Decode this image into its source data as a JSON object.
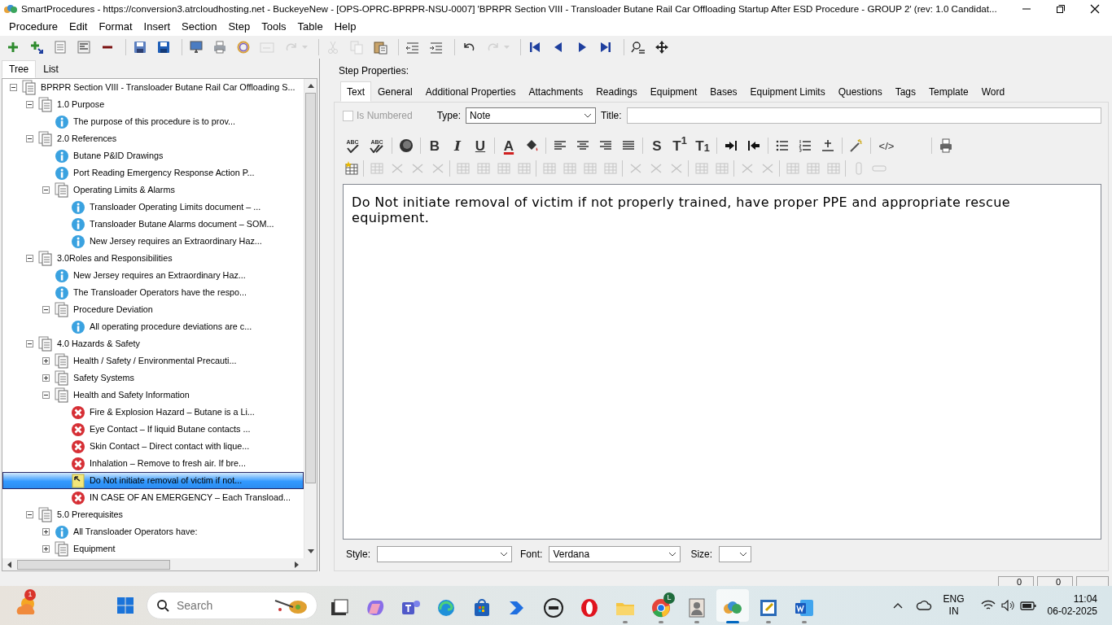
{
  "window": {
    "title": "SmartProcedures - https://conversion3.atrcloudhosting.net - BuckeyeNew - [OPS-OPRC-BPRPR-NSU-0007] 'BPRPR Section VIII - Transloader Butane Rail Car Offloading Startup After ESD Procedure - GROUP 2' (rev: 1.0 Candidat..."
  },
  "menu": [
    "Procedure",
    "Edit",
    "Format",
    "Insert",
    "Section",
    "Step",
    "Tools",
    "Table",
    "Help"
  ],
  "toolbar": [
    {
      "kind": "add",
      "disabled": false
    },
    {
      "kind": "addchild",
      "disabled": false
    },
    {
      "kind": "props",
      "disabled": false
    },
    {
      "kind": "props2",
      "disabled": false
    },
    {
      "kind": "remove",
      "disabled": false
    },
    {
      "kind": "sep"
    },
    {
      "kind": "saveas",
      "disabled": false
    },
    {
      "kind": "save",
      "disabled": false
    },
    {
      "kind": "sep"
    },
    {
      "kind": "monitor",
      "disabled": false
    },
    {
      "kind": "print",
      "disabled": false
    },
    {
      "kind": "ring",
      "disabled": false
    },
    {
      "kind": "window",
      "disabled": true
    },
    {
      "kind": "redo",
      "disabled": true
    },
    {
      "kind": "sep"
    },
    {
      "kind": "cut",
      "disabled": true
    },
    {
      "kind": "copy",
      "disabled": true
    },
    {
      "kind": "paste",
      "disabled": false
    },
    {
      "kind": "sep"
    },
    {
      "kind": "outdent",
      "disabled": false
    },
    {
      "kind": "indent",
      "disabled": false
    },
    {
      "kind": "sep"
    },
    {
      "kind": "undo",
      "disabled": false
    },
    {
      "kind": "redo",
      "disabled": true
    },
    {
      "kind": "sep"
    },
    {
      "kind": "first",
      "disabled": false
    },
    {
      "kind": "prev",
      "disabled": false
    },
    {
      "kind": "next",
      "disabled": false
    },
    {
      "kind": "last",
      "disabled": false
    },
    {
      "kind": "sep"
    },
    {
      "kind": "find",
      "disabled": false
    },
    {
      "kind": "move",
      "disabled": false
    }
  ],
  "left_tabs": [
    {
      "label": "Tree",
      "selected": true
    },
    {
      "label": "List",
      "selected": false
    }
  ],
  "tree": [
    {
      "label": "BPRPR Section VIII - Transloader Butane Rail Car Offloading S...",
      "kind": "section",
      "expanded": true,
      "selected": false,
      "children": [
        {
          "label": "1.0 Purpose",
          "kind": "section",
          "expanded": true,
          "selected": false,
          "children": [
            {
              "label": "The purpose of this procedure is to prov...",
              "kind": "info",
              "selected": false
            }
          ]
        },
        {
          "label": "2.0 References",
          "kind": "section",
          "expanded": true,
          "selected": false,
          "children": [
            {
              "label": "Butane P&ID Drawings",
              "kind": "info",
              "selected": false
            },
            {
              "label": "Port Reading Emergency Response Action P...",
              "kind": "info",
              "selected": false
            },
            {
              "label": "Operating Limits & Alarms",
              "kind": "section",
              "expanded": true,
              "selected": false,
              "children": [
                {
                  "label": "Transloader Operating Limits document – ...",
                  "kind": "info",
                  "selected": false
                },
                {
                  "label": "Transloader Butane Alarms document – SOM...",
                  "kind": "info",
                  "selected": false
                },
                {
                  "label": "New Jersey requires an Extraordinary Haz...",
                  "kind": "info",
                  "selected": false
                }
              ]
            }
          ]
        },
        {
          "label": "3.0Roles and Responsibilities",
          "kind": "section",
          "expanded": true,
          "selected": false,
          "children": [
            {
              "label": "New Jersey requires an Extraordinary Haz...",
              "kind": "info",
              "selected": false
            },
            {
              "label": "The Transloader Operators have the respo...",
              "kind": "info",
              "selected": false
            },
            {
              "label": "Procedure Deviation",
              "kind": "section",
              "expanded": true,
              "selected": false,
              "children": [
                {
                  "label": "All operating procedure deviations are c...",
                  "kind": "info",
                  "selected": false
                }
              ]
            }
          ]
        },
        {
          "label": "4.0 Hazards & Safety",
          "kind": "section",
          "expanded": true,
          "selected": false,
          "children": [
            {
              "label": "Health / Safety / Environmental Precauti...",
              "kind": "section",
              "expanded": false,
              "selected": false
            },
            {
              "label": "Safety Systems",
              "kind": "section",
              "expanded": false,
              "selected": false
            },
            {
              "label": "Health and Safety Information",
              "kind": "section",
              "expanded": true,
              "selected": false,
              "children": [
                {
                  "label": "Fire & Explosion Hazard – Butane is a Li...",
                  "kind": "hazard",
                  "selected": false
                },
                {
                  "label": "Eye Contact – If liquid Butane contacts ...",
                  "kind": "hazard",
                  "selected": false
                },
                {
                  "label": "Skin Contact – Direct contact with lique...",
                  "kind": "hazard",
                  "selected": false
                },
                {
                  "label": "Inhalation – Remove to fresh air. If bre...",
                  "kind": "hazard",
                  "selected": false
                },
                {
                  "label": "Do Not initiate removal of victim if not...",
                  "kind": "note",
                  "selected": true
                },
                {
                  "label": "IN CASE OF AN EMERGENCY – Each Transload...",
                  "kind": "hazard",
                  "selected": false
                }
              ]
            }
          ]
        },
        {
          "label": "5.0 Prerequisites",
          "kind": "section",
          "expanded": true,
          "selected": false,
          "children": [
            {
              "label": "All Transloader Operators have:",
              "kind": "info",
              "expanded": false,
              "selected": false
            },
            {
              "label": "Equipment",
              "kind": "section",
              "expanded": false,
              "selected": false
            }
          ]
        }
      ]
    }
  ],
  "step_properties": {
    "heading": "Step Properties:",
    "tabs": [
      {
        "label": "Text",
        "selected": true
      },
      {
        "label": "General",
        "selected": false
      },
      {
        "label": "Additional Properties",
        "selected": false
      },
      {
        "label": "Attachments",
        "selected": false
      },
      {
        "label": "Readings",
        "selected": false
      },
      {
        "label": "Equipment",
        "selected": false
      },
      {
        "label": "Bases",
        "selected": false
      },
      {
        "label": "Equipment Limits",
        "selected": false
      },
      {
        "label": "Questions",
        "selected": false
      },
      {
        "label": "Tags",
        "selected": false
      },
      {
        "label": "Template",
        "selected": false
      },
      {
        "label": "Word",
        "selected": false
      }
    ],
    "is_numbered": {
      "label": "Is Numbered",
      "checked": false,
      "disabled": true
    },
    "type_label": "Type:",
    "type_value": "Note",
    "title_label": "Title:",
    "editor_toolbar_1": [
      {
        "kind": "spell",
        "label": "ABC"
      },
      {
        "kind": "spellall",
        "label": "ABC"
      },
      {
        "kind": "sep"
      },
      {
        "kind": "globe"
      },
      {
        "kind": "sep"
      },
      {
        "kind": "bold",
        "label": "B"
      },
      {
        "kind": "italic",
        "label": "I"
      },
      {
        "kind": "underline",
        "label": "U"
      },
      {
        "kind": "sep"
      },
      {
        "kind": "fontcolor",
        "label": "A"
      },
      {
        "kind": "fill"
      },
      {
        "kind": "sep"
      },
      {
        "kind": "alignleft"
      },
      {
        "kind": "aligncenter"
      },
      {
        "kind": "alignright"
      },
      {
        "kind": "justify"
      },
      {
        "kind": "sep"
      },
      {
        "kind": "strike",
        "label": "S"
      },
      {
        "kind": "script",
        "label": "T$^{1}$"
      },
      {
        "kind": "script",
        "label": "T$_{1}$"
      },
      {
        "kind": "sep"
      },
      {
        "kind": "indent"
      },
      {
        "kind": "outdent"
      },
      {
        "kind": "sep"
      },
      {
        "kind": "bullets"
      },
      {
        "kind": "numbers"
      },
      {
        "kind": "hr"
      },
      {
        "kind": "sep"
      },
      {
        "kind": "wand"
      },
      {
        "kind": "sep"
      },
      {
        "kind": "code",
        "label": "</>"
      },
      {
        "kind": "gap"
      },
      {
        "kind": "sep"
      },
      {
        "kind": "print"
      }
    ],
    "editor_toolbar_2": [
      {
        "kind": "newtable",
        "disabled": false
      },
      {
        "kind": "sep"
      },
      {
        "kind": "table",
        "disabled": true
      },
      {
        "kind": "cells",
        "disabled": true
      },
      {
        "kind": "cells",
        "disabled": true
      },
      {
        "kind": "cells",
        "disabled": true
      },
      {
        "kind": "sep"
      },
      {
        "kind": "table",
        "disabled": true
      },
      {
        "kind": "table",
        "disabled": true
      },
      {
        "kind": "table",
        "disabled": true
      },
      {
        "kind": "table",
        "disabled": true
      },
      {
        "kind": "sep"
      },
      {
        "kind": "table",
        "disabled": true
      },
      {
        "kind": "table",
        "disabled": true
      },
      {
        "kind": "table",
        "disabled": true
      },
      {
        "kind": "table",
        "disabled": true
      },
      {
        "kind": "sep"
      },
      {
        "kind": "cells",
        "disabled": true
      },
      {
        "kind": "cells",
        "disabled": true
      },
      {
        "kind": "cells",
        "disabled": true
      },
      {
        "kind": "sep"
      },
      {
        "kind": "table",
        "disabled": true
      },
      {
        "kind": "table",
        "disabled": true
      },
      {
        "kind": "sep"
      },
      {
        "kind": "cells",
        "disabled": true
      },
      {
        "kind": "cells",
        "disabled": true
      },
      {
        "kind": "sep"
      },
      {
        "kind": "table",
        "disabled": true
      },
      {
        "kind": "table",
        "disabled": true
      },
      {
        "kind": "table",
        "disabled": true
      },
      {
        "kind": "sep"
      },
      {
        "kind": "bar",
        "disabled": true
      },
      {
        "kind": "field",
        "disabled": true
      }
    ],
    "editor_text": "Do Not initiate removal of victim if not properly trained, have proper PPE and appropriate rescue equipment.",
    "style_label": "Style:",
    "font_label": "Font:",
    "font_value": "Verdana",
    "size_label": "Size:"
  },
  "status_bar": [
    "0",
    "0"
  ],
  "taskbar": {
    "weather_badge": "1",
    "search_placeholder": "Search",
    "apps": [
      {
        "kind": "files",
        "running": false
      },
      {
        "kind": "copilot",
        "running": false
      },
      {
        "kind": "teams",
        "running": false
      },
      {
        "kind": "edge",
        "running": false
      },
      {
        "kind": "store",
        "running": false
      },
      {
        "kind": "automate",
        "running": false
      },
      {
        "kind": "dell",
        "running": false
      },
      {
        "kind": "opera",
        "running": false
      },
      {
        "kind": "folder",
        "running": true
      },
      {
        "kind": "chrome",
        "running": true,
        "badge": "L"
      },
      {
        "kind": "person",
        "running": true
      },
      {
        "kind": "smartproc",
        "running": true,
        "active": true
      },
      {
        "kind": "editor",
        "running": true
      },
      {
        "kind": "word",
        "running": true
      }
    ],
    "language": "ENG",
    "region": "IN",
    "time": "11:04",
    "date": "06-02-2025"
  }
}
